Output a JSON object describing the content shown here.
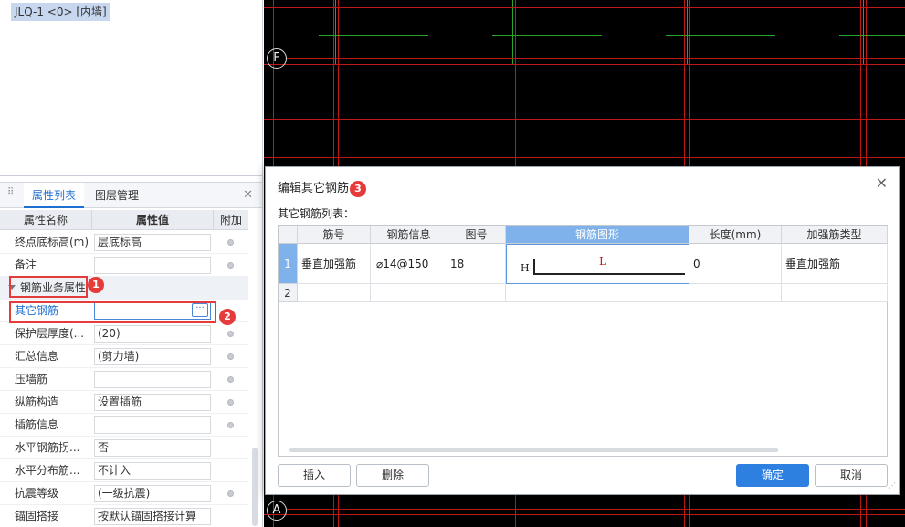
{
  "tree": {
    "selected_item": "JLQ-1 <0> [内墙]"
  },
  "tabs": [
    {
      "label": "属性列表",
      "active": true
    },
    {
      "label": "图层管理",
      "active": false
    }
  ],
  "prop_header": {
    "name": "属性名称",
    "value": "属性值",
    "extra": "附加"
  },
  "props": {
    "r0": {
      "name": "终点底标高(m)",
      "value": "层底标高"
    },
    "r1": {
      "name": "备注",
      "value": ""
    },
    "group": {
      "label": "钢筋业务属性"
    },
    "r2": {
      "name": "其它钢筋",
      "value": ""
    },
    "r3": {
      "name": "保护层厚度(...",
      "value": "(20)"
    },
    "r4": {
      "name": "汇总信息",
      "value": "(剪力墙)"
    },
    "r5": {
      "name": "压墙筋",
      "value": ""
    },
    "r6": {
      "name": "纵筋构造",
      "value": "设置插筋"
    },
    "r7": {
      "name": "插筋信息",
      "value": ""
    },
    "r8": {
      "name": "水平钢筋拐...",
      "value": "否"
    },
    "r9": {
      "name": "水平分布筋...",
      "value": "不计入"
    },
    "r10": {
      "name": "抗震等级",
      "value": "(一级抗震)"
    },
    "r11": {
      "name": "锚固搭接",
      "value": "按默认锚固搭接计算"
    }
  },
  "badges": {
    "b1": "1",
    "b2": "2",
    "b3": "3"
  },
  "axis": {
    "top": "F",
    "bottom": "A"
  },
  "dialog": {
    "title": "编辑其它钢筋",
    "subtitle": "其它钢筋列表：",
    "columns": {
      "c0": "筋号",
      "c1": "钢筋信息",
      "c2": "图号",
      "c3": "钢筋图形",
      "c4": "长度(mm)",
      "c5": "加强筋类型"
    },
    "rows": [
      {
        "num": "1",
        "bar_no": "垂直加强筋",
        "bar_info": "⌀14@150",
        "fig_no": "18",
        "shape_h": "H",
        "shape_l": "L",
        "length": "0",
        "type": "垂直加强筋"
      },
      {
        "num": "2"
      }
    ],
    "buttons": {
      "insert": "插入",
      "delete": "删除",
      "ok": "确定",
      "cancel": "取消"
    }
  },
  "colors": {
    "accent": "#2d7fe0",
    "highlight_red": "#e63b3b",
    "cad_red": "#c21818",
    "cad_green": "#2aa52a"
  }
}
